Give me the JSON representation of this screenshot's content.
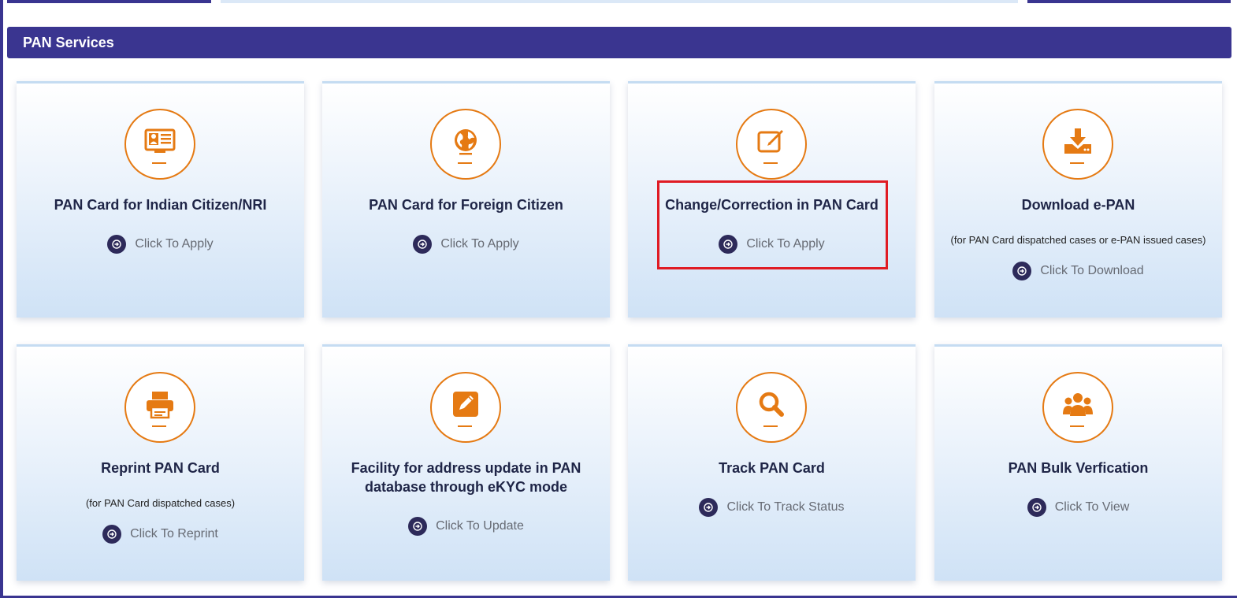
{
  "section": {
    "title": "PAN Services"
  },
  "colors": {
    "primary": "#3a3590",
    "accent": "#e57a13",
    "action": "#2d2a5a",
    "highlight": "#e01b24"
  },
  "cards": [
    {
      "title": "PAN Card for Indian Citizen/NRI",
      "note": "",
      "action": "Click To Apply",
      "icon": "id-card-icon"
    },
    {
      "title": "PAN Card for Foreign Citizen",
      "note": "",
      "action": "Click To Apply",
      "icon": "globe-icon"
    },
    {
      "title": "Change/Correction in PAN Card",
      "note": "",
      "action": "Click To Apply",
      "icon": "edit-icon"
    },
    {
      "title": "Download e-PAN",
      "note": "(for PAN Card dispatched cases or e-PAN issued cases)",
      "action": "Click To Download",
      "icon": "download-icon"
    },
    {
      "title": "Reprint PAN Card",
      "note": "(for PAN Card dispatched cases)",
      "action": "Click To Reprint",
      "icon": "printer-icon"
    },
    {
      "title_line1": "Facility for address update in PAN",
      "title_line2": "database through eKYC mode",
      "note": "",
      "action": "Click To Update",
      "icon": "pencil-square-icon"
    },
    {
      "title": "Track PAN Card",
      "note": "",
      "action": "Click To Track Status",
      "icon": "search-icon"
    },
    {
      "title": "PAN Bulk Verfication",
      "note": "",
      "action": "Click To View",
      "icon": "users-icon"
    }
  ]
}
